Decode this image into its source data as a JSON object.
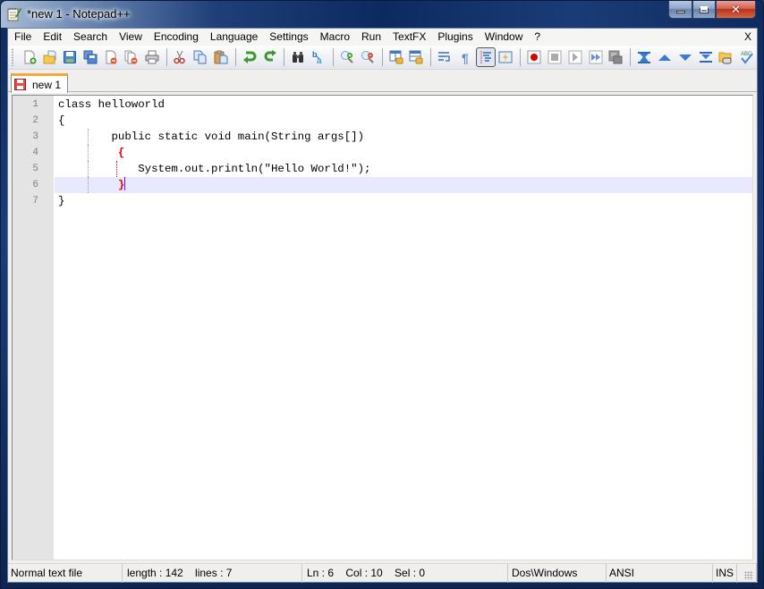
{
  "window": {
    "title": "*new  1 - Notepad++",
    "controls": {
      "minimize": "minimize",
      "maximize": "maximize",
      "close": "close"
    }
  },
  "menubar": {
    "items": [
      "File",
      "Edit",
      "Search",
      "View",
      "Encoding",
      "Language",
      "Settings",
      "Macro",
      "Run",
      "TextFX",
      "Plugins",
      "Window",
      "?"
    ],
    "close_doc": "X"
  },
  "toolbar": {
    "buttons": [
      "new-file",
      "open-file",
      "save",
      "save-all",
      "close",
      "close-all",
      "print",
      "|",
      "cut",
      "copy",
      "paste",
      "|",
      "undo",
      "redo",
      "|",
      "find",
      "replace",
      "|",
      "zoom-in",
      "zoom-out",
      "|",
      "sync-vertical-scroll",
      "sync-horizontal-scroll",
      "|",
      "word-wrap",
      "show-all-characters",
      "indent-guide",
      "user-defined-language",
      "|",
      "start-recording",
      "stop-recording",
      "playback",
      "run-macro-multiple",
      "save-macro",
      "|",
      "fold-all",
      "collapse",
      "expand",
      "unfold-all",
      "open-in-explorer",
      "spell-check"
    ],
    "pressed": "indent-guide"
  },
  "tabs": [
    {
      "label": "new  1",
      "modified": true,
      "active": true
    }
  ],
  "editor": {
    "lines": [
      {
        "n": "1",
        "text": "class helloworld"
      },
      {
        "n": "2",
        "text": "{"
      },
      {
        "n": "3",
        "text": "        public static void main(String args[])"
      },
      {
        "n": "4",
        "text": "         {",
        "brace": true
      },
      {
        "n": "5",
        "text": "            System.out.println(\"Hello World!\");"
      },
      {
        "n": "6",
        "text": "         }",
        "brace": true,
        "current": true
      },
      {
        "n": "7",
        "text": "}"
      }
    ],
    "highlight_color": "#e8e8ff",
    "brace_color": "#e00000",
    "caret_color": "#8000ff"
  },
  "statusbar": {
    "file_type": "Normal text file",
    "length_lines": "length : 142    lines : 7",
    "position": "Ln : 6    Col : 10    Sel : 0",
    "eol": "Dos\\Windows",
    "encoding": "ANSI",
    "mode": "INS"
  }
}
